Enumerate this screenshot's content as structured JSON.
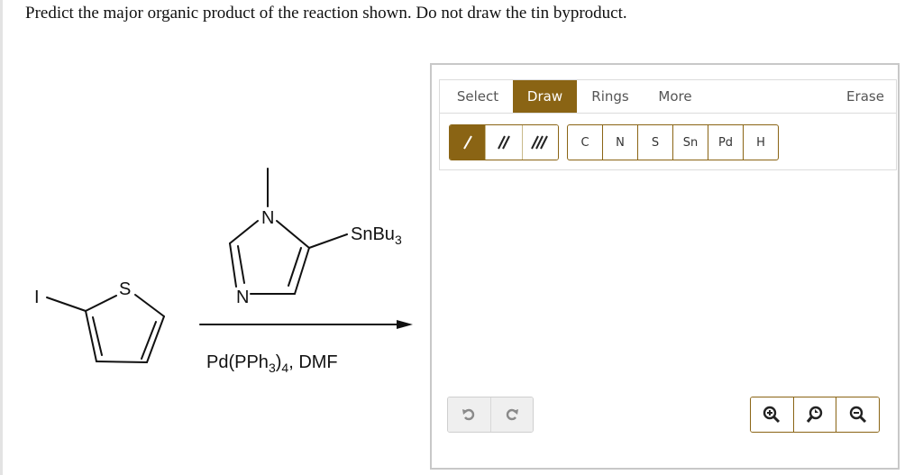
{
  "question": "Predict the major organic product of the reaction shown. Do not draw the tin byproduct.",
  "reaction": {
    "iodo": "I",
    "thiophene_s": "S",
    "imidazole_n1": "N",
    "imidazole_n3": "N",
    "stannane": "SnBu",
    "stannane_sub": "3",
    "reagent_1": "Pd(PPh",
    "reagent_sub1": "3",
    "reagent_2": ")",
    "reagent_sub2": "4",
    "reagent_3": ", DMF"
  },
  "toolbar": {
    "tabs": [
      {
        "label": "Select"
      },
      {
        "label": "Draw"
      },
      {
        "label": "Rings"
      },
      {
        "label": "More"
      },
      {
        "label": "Erase"
      }
    ],
    "active_tab": "Draw"
  },
  "bond_tools": [
    "single-bond-icon",
    "double-bond-icon",
    "triple-bond-icon"
  ],
  "atoms": [
    "C",
    "N",
    "S",
    "Sn",
    "Pd",
    "H"
  ],
  "history": [
    "undo-icon",
    "redo-icon"
  ],
  "zoom": [
    "zoom-in-icon",
    "zoom-reset-icon",
    "zoom-out-icon"
  ],
  "colors": {
    "accent": "#8a6414",
    "border": "#c8c8c8"
  }
}
